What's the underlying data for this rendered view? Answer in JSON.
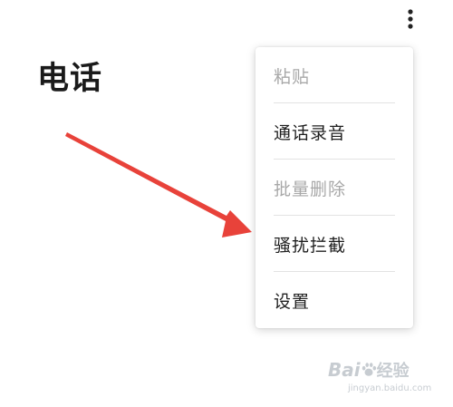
{
  "header": {
    "title": "电话",
    "more_icon": "more-vert-icon"
  },
  "menu": {
    "items": [
      {
        "label": "粘贴",
        "enabled": false
      },
      {
        "label": "通话录音",
        "enabled": true
      },
      {
        "label": "批量删除",
        "enabled": false
      },
      {
        "label": "骚扰拦截",
        "enabled": true
      },
      {
        "label": "设置",
        "enabled": true
      }
    ]
  },
  "annotation": {
    "arrow_color": "#e8423a",
    "points_to": "骚扰拦截"
  },
  "watermark": {
    "brand": "Bai",
    "brand_suffix": "经验",
    "url": "jingyan.baidu.com"
  },
  "colors": {
    "text_primary": "#1f1f1f",
    "text_disabled": "#a8a8a8",
    "divider": "#e3e3e3"
  }
}
